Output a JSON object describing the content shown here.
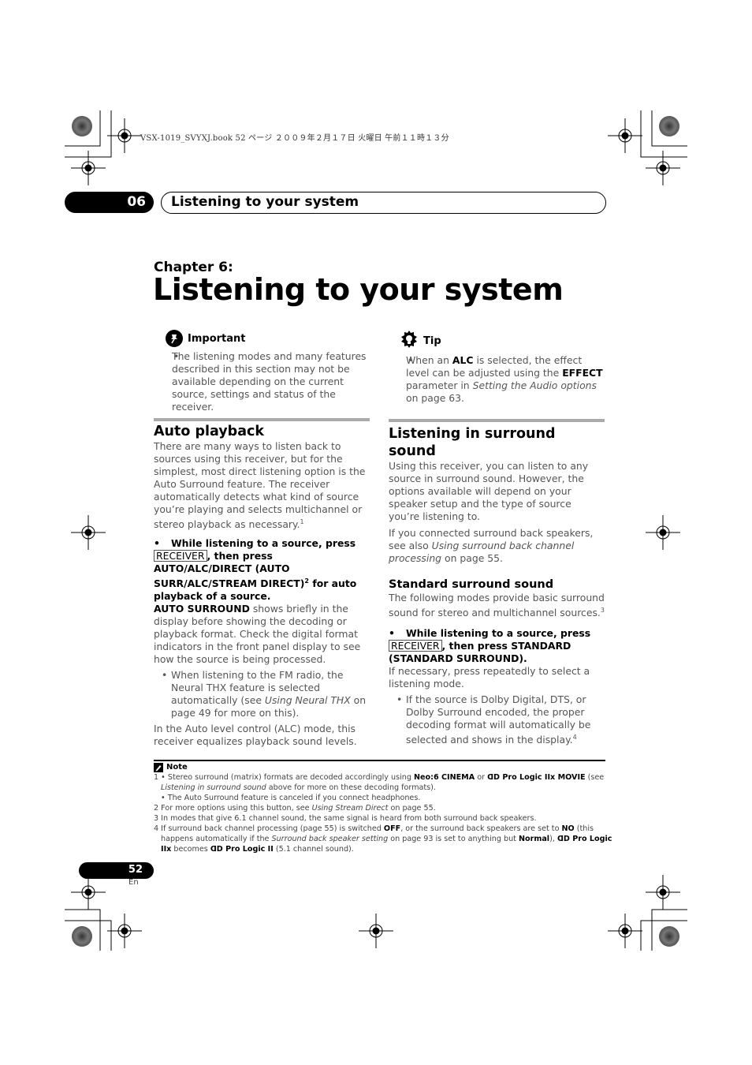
{
  "print_meta": "VSX-1019_SVYXJ.book  52 ページ  ２００９年２月１７日  火曜日  午前１１時１３分",
  "header": {
    "chapter_number": "06",
    "section_title": "Listening to your system"
  },
  "chapter": {
    "label": "Chapter 6:",
    "title": "Listening to your system"
  },
  "important": {
    "icon": "important-pin-icon",
    "title": "Important",
    "text": "The listening modes and many features described in this section may not be available depending on the current source, settings and status of the receiver."
  },
  "tip": {
    "icon": "tip-lightbulb-icon",
    "title": "Tip",
    "p1": "When an ",
    "b1": "ALC",
    "p2": " is selected, the effect level can be adjusted using the ",
    "b2": "EFFECT",
    "p3": " parameter in ",
    "i1": "Setting the Audio options",
    "p4": " on page 63."
  },
  "auto_playback": {
    "heading": "Auto playback",
    "intro": "There are many ways to listen back to sources using this receiver, but for the simplest, most direct listening option is the Auto Surround feature. The receiver automatically detects what kind of source you’re playing and selects multichannel or stereo playback as necessary.",
    "intro_sup": "1",
    "step_a": "While listening to a source, press",
    "step_key": "RECEIVER",
    "step_b": ", then press AUTO/ALC/DIRECT (AUTO SURR/ALC/STREAM DIRECT)",
    "step_sup": "2",
    "step_c": " for auto playback of a source.",
    "result_bold": "AUTO SURROUND",
    "result_text": " shows briefly in the display before showing the decoding or playback format. Check the digital format indicators in the front panel display to see how the source is being processed.",
    "bullet_a": "When listening to the FM radio, the Neural THX feature is selected automatically (see ",
    "bullet_i": "Using Neural THX",
    "bullet_b": " on page 49 for more on this).",
    "alc_text": "In the Auto level control (ALC) mode, this receiver equalizes playback sound levels."
  },
  "surround": {
    "heading": "Listening in surround sound",
    "intro": "Using this receiver, you can listen to any source in surround sound. However, the options available will depend on your speaker setup and the type of source you’re listening to.",
    "back_a": "If you connected surround back speakers, see also ",
    "back_i": "Using surround back channel processing",
    "back_b": " on page 55.",
    "sub_heading": "Standard surround sound",
    "sub_intro": "The following modes provide basic surround sound for stereo and multichannel sources.",
    "sub_sup": "3",
    "step_a": "While listening to a source, press",
    "step_key": "RECEIVER",
    "step_b": ", then press STANDARD (STANDARD SURROUND).",
    "repeat_text": "If necessary, press repeatedly to select a listening mode.",
    "bullet": "If the source is Dolby Digital, DTS, or Dolby Surround encoded, the proper decoding format will automatically be selected and shows in the display.",
    "bullet_sup": "4"
  },
  "notes": {
    "title": "Note",
    "n1a_pre": "1 • Stereo surround (matrix) formats are decoded accordingly using ",
    "n1a_b1": "Neo:6 CINEMA",
    "n1a_mid": " or ",
    "n1a_b2": "ᗡᗞ Pro Logic IIx MOVIE",
    "n1a_post": " (see",
    "n1b_i": "Listening in surround sound",
    "n1b_post": " above for more on these decoding formats).",
    "n1c": "• The Auto Surround feature is canceled if you connect headphones.",
    "n2_pre": "2 For more options using this button, see ",
    "n2_i": "Using Stream Direct",
    "n2_post": " on page 55.",
    "n3": "3 In modes that give 6.1 channel sound, the same signal is heard from both surround back speakers.",
    "n4a_pre": "4 If surround back channel processing (page 55) is switched ",
    "n4a_b1": "OFF",
    "n4a_mid": ", or the surround back speakers are set to ",
    "n4a_b2": "NO",
    "n4a_post": " (this",
    "n4b_pre": "happens automatically if the ",
    "n4b_i": "Surround back speaker setting",
    "n4b_mid": " on page 93 is set to anything but ",
    "n4b_b1": "Normal",
    "n4b_mid2": "), ",
    "n4b_b2": "ᗡᗞ Pro Logic",
    "n4c_b1": "IIx",
    "n4c_mid": " becomes ",
    "n4c_b2": "ᗡᗞ Pro Logic II",
    "n4c_post": " (5.1 channel sound)."
  },
  "footer": {
    "page_number": "52",
    "language": "En"
  }
}
